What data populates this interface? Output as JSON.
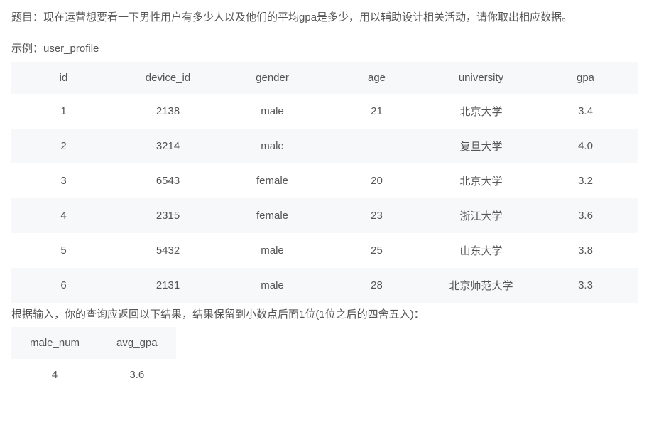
{
  "question": {
    "prefix": "题目：",
    "body": "现在运营想要看一下男性用户有多少人以及他们的平均gpa是多少，用以辅助设计相关活动，请你取出相应数据。"
  },
  "example_label": "示例：user_profile",
  "table1": {
    "headers": [
      "id",
      "device_id",
      "gender",
      "age",
      "university",
      "gpa"
    ],
    "rows": [
      [
        "1",
        "2138",
        "male",
        "21",
        "北京大学",
        "3.4"
      ],
      [
        "2",
        "3214",
        "male",
        "",
        "复旦大学",
        "4.0"
      ],
      [
        "3",
        "6543",
        "female",
        "20",
        "北京大学",
        "3.2"
      ],
      [
        "4",
        "2315",
        "female",
        "23",
        "浙江大学",
        "3.6"
      ],
      [
        "5",
        "5432",
        "male",
        "25",
        "山东大学",
        "3.8"
      ],
      [
        "6",
        "2131",
        "male",
        "28",
        "北京师范大学",
        "3.3"
      ]
    ]
  },
  "result_text": "根据输入，你的查询应返回以下结果，结果保留到小数点后面1位(1位之后的四舍五入)：",
  "table2": {
    "headers": [
      "male_num",
      "avg_gpa"
    ],
    "rows": [
      [
        "4",
        "3.6"
      ]
    ]
  }
}
